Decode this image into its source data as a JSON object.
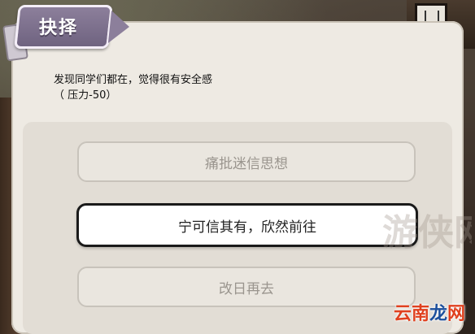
{
  "dialog": {
    "title": "抉择",
    "description_line1": "发现同学们都在，觉得很有安全感",
    "description_line2": "（ 压力-50）"
  },
  "choices": [
    {
      "label": "痛批迷信思想",
      "state": "disabled"
    },
    {
      "label": "宁可信其有，欣然前往",
      "state": "active"
    },
    {
      "label": "改日再去",
      "state": "disabled"
    }
  ],
  "watermark": {
    "faint_text": "游侠网",
    "text_part1": "云南",
    "text_part2": "龙",
    "text_part3": "网"
  },
  "colors": {
    "dialog_bg": "#eeeae3",
    "title_tab": "#8c7f9b",
    "active_border": "#1a1a1a",
    "disabled_text": "#9a958e"
  }
}
